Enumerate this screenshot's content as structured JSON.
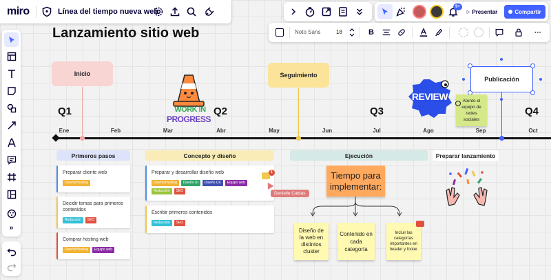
{
  "app": {
    "logo": "miro",
    "board_name": "Línea del tiempo nueva web",
    "present_label": "Presentar",
    "share_label": "Compartir",
    "notif_count": "9+"
  },
  "format_bar": {
    "font": "Noto Sans",
    "font_size": "18"
  },
  "board": {
    "title": "Lanzamiento sitio web",
    "stages": [
      "Inicio",
      "Seguimiento",
      "Publicación"
    ],
    "quarters": [
      "Q1",
      "Q2",
      "Q3",
      "Q4"
    ],
    "months": [
      "Ene",
      "Feb",
      "Mar",
      "Abr",
      "May",
      "Jun",
      "Jul",
      "Ago",
      "Sep",
      "Oct"
    ],
    "sticker_wip": [
      "WORK IN",
      "PROGRESS"
    ],
    "sticker_review": "REVIEW",
    "side_note": "Atento el equipo de redes sociales"
  },
  "columns": {
    "col1": {
      "title": "Primeros pasos",
      "cards": [
        {
          "text": "Preparar cliente web",
          "tags": [
            {
              "label": "Diseño/Hosting",
              "color": "#f2b233"
            }
          ]
        },
        {
          "text": "Decidir temas para primeros contenidos",
          "tags": [
            {
              "label": "Redacción",
              "color": "#35c0d6"
            },
            {
              "label": "SEO",
              "color": "#e0513e"
            }
          ]
        },
        {
          "text": "Comprar hosting web",
          "tags": [
            {
              "label": "Diseño/Hosting",
              "color": "#f2b233"
            },
            {
              "label": "Equipo web",
              "color": "#8c2ca8"
            }
          ]
        }
      ]
    },
    "col2": {
      "title": "Concepto y diseño",
      "cards": [
        {
          "text": "Preparar y desarrollar diseño web",
          "tags": [
            {
              "label": "Diseño/Hosting",
              "color": "#f2b233"
            },
            {
              "label": "Diseño UI",
              "color": "#31a36b"
            },
            {
              "label": "Diseño UX",
              "color": "#3f4fb0"
            },
            {
              "label": "Equipo web",
              "color": "#8c2ca8"
            },
            {
              "label": "Redacción",
              "color": "#9bc23c"
            },
            {
              "label": "SEO",
              "color": "#e0513e"
            }
          ]
        },
        {
          "text": "Escribir primeros contenidos",
          "tags": [
            {
              "label": "Redacción",
              "color": "#35c0d6"
            },
            {
              "label": "SEO",
              "color": "#e0513e"
            }
          ]
        }
      ],
      "cursor_user": "Denielle Caldas",
      "badge_count": "1"
    },
    "col3": {
      "title": "Ejecución",
      "main_note": "Tiempo para implementar:",
      "notes": [
        "Diseño de la web en distintos cluster",
        "Contenido en cada categoría",
        "Incluir las categorías importantes en header y footer"
      ]
    },
    "col4": {
      "title": "Preparar lanzamiento"
    }
  },
  "colors": {
    "accent": "#4262ff",
    "stage_pink": "#f8d5d3",
    "stage_yellow": "#fbe39a",
    "head_blue": "#dde3fb",
    "head_yellow": "#faecb6",
    "head_teal": "#d5e9e6",
    "sticky_yellow": "#fff9b1",
    "sticky_orange": "#ffa95f",
    "sticky_green": "#d5e88a"
  }
}
